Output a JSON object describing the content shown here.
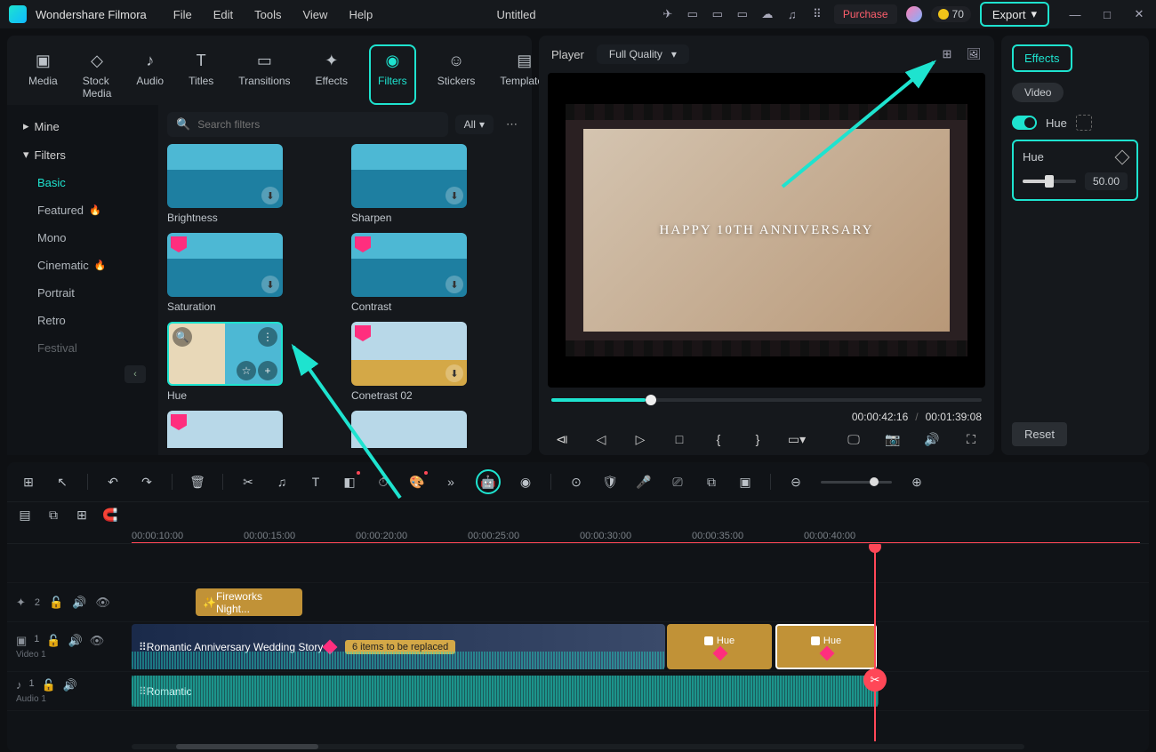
{
  "app_name": "Wondershare Filmora",
  "menus": [
    "File",
    "Edit",
    "Tools",
    "View",
    "Help"
  ],
  "document_title": "Untitled",
  "purchase": "Purchase",
  "credits": "70",
  "export": "Export",
  "tabs": {
    "media": "Media",
    "stock": "Stock Media",
    "audio": "Audio",
    "titles": "Titles",
    "transitions": "Transitions",
    "effects": "Effects",
    "filters": "Filters",
    "stickers": "Stickers",
    "templates": "Templates"
  },
  "sidebar": {
    "mine": "Mine",
    "filters": "Filters",
    "items": [
      "Basic",
      "Featured",
      "Mono",
      "Cinematic",
      "Portrait",
      "Retro",
      "Festival"
    ]
  },
  "search": {
    "placeholder": "Search filters",
    "filter_all": "All"
  },
  "gallery": [
    {
      "name": "Brightness"
    },
    {
      "name": "Sharpen"
    },
    {
      "name": "Saturation"
    },
    {
      "name": "Contrast"
    },
    {
      "name": "Hue"
    },
    {
      "name": "Conetrast 02"
    },
    {
      "name": ""
    },
    {
      "name": ""
    }
  ],
  "player": {
    "label": "Player",
    "quality": "Full Quality",
    "overlay_text": "HAPPY 10TH ANNIVERSARY",
    "time_current": "00:00:42:16",
    "time_total": "00:01:39:08"
  },
  "effects": {
    "tab": "Effects",
    "video": "Video",
    "hue_toggle": "Hue",
    "hue_label": "Hue",
    "hue_value": "50.00",
    "reset": "Reset"
  },
  "ruler": [
    "00:00:10:00",
    "00:00:15:00",
    "00:00:20:00",
    "00:00:25:00",
    "00:00:30:00",
    "00:00:35:00",
    "00:00:40:00"
  ],
  "tracks": {
    "fx2": "2",
    "video1_name": "Video 1",
    "audio1_name": "Audio 1",
    "fire_clip": "Fireworks Night...",
    "video_clip": "Romantic Anniversary Wedding Story",
    "replace_badge": "6 items to be replaced",
    "hue_clip": "Hue",
    "audio_clip": "Romantic"
  }
}
